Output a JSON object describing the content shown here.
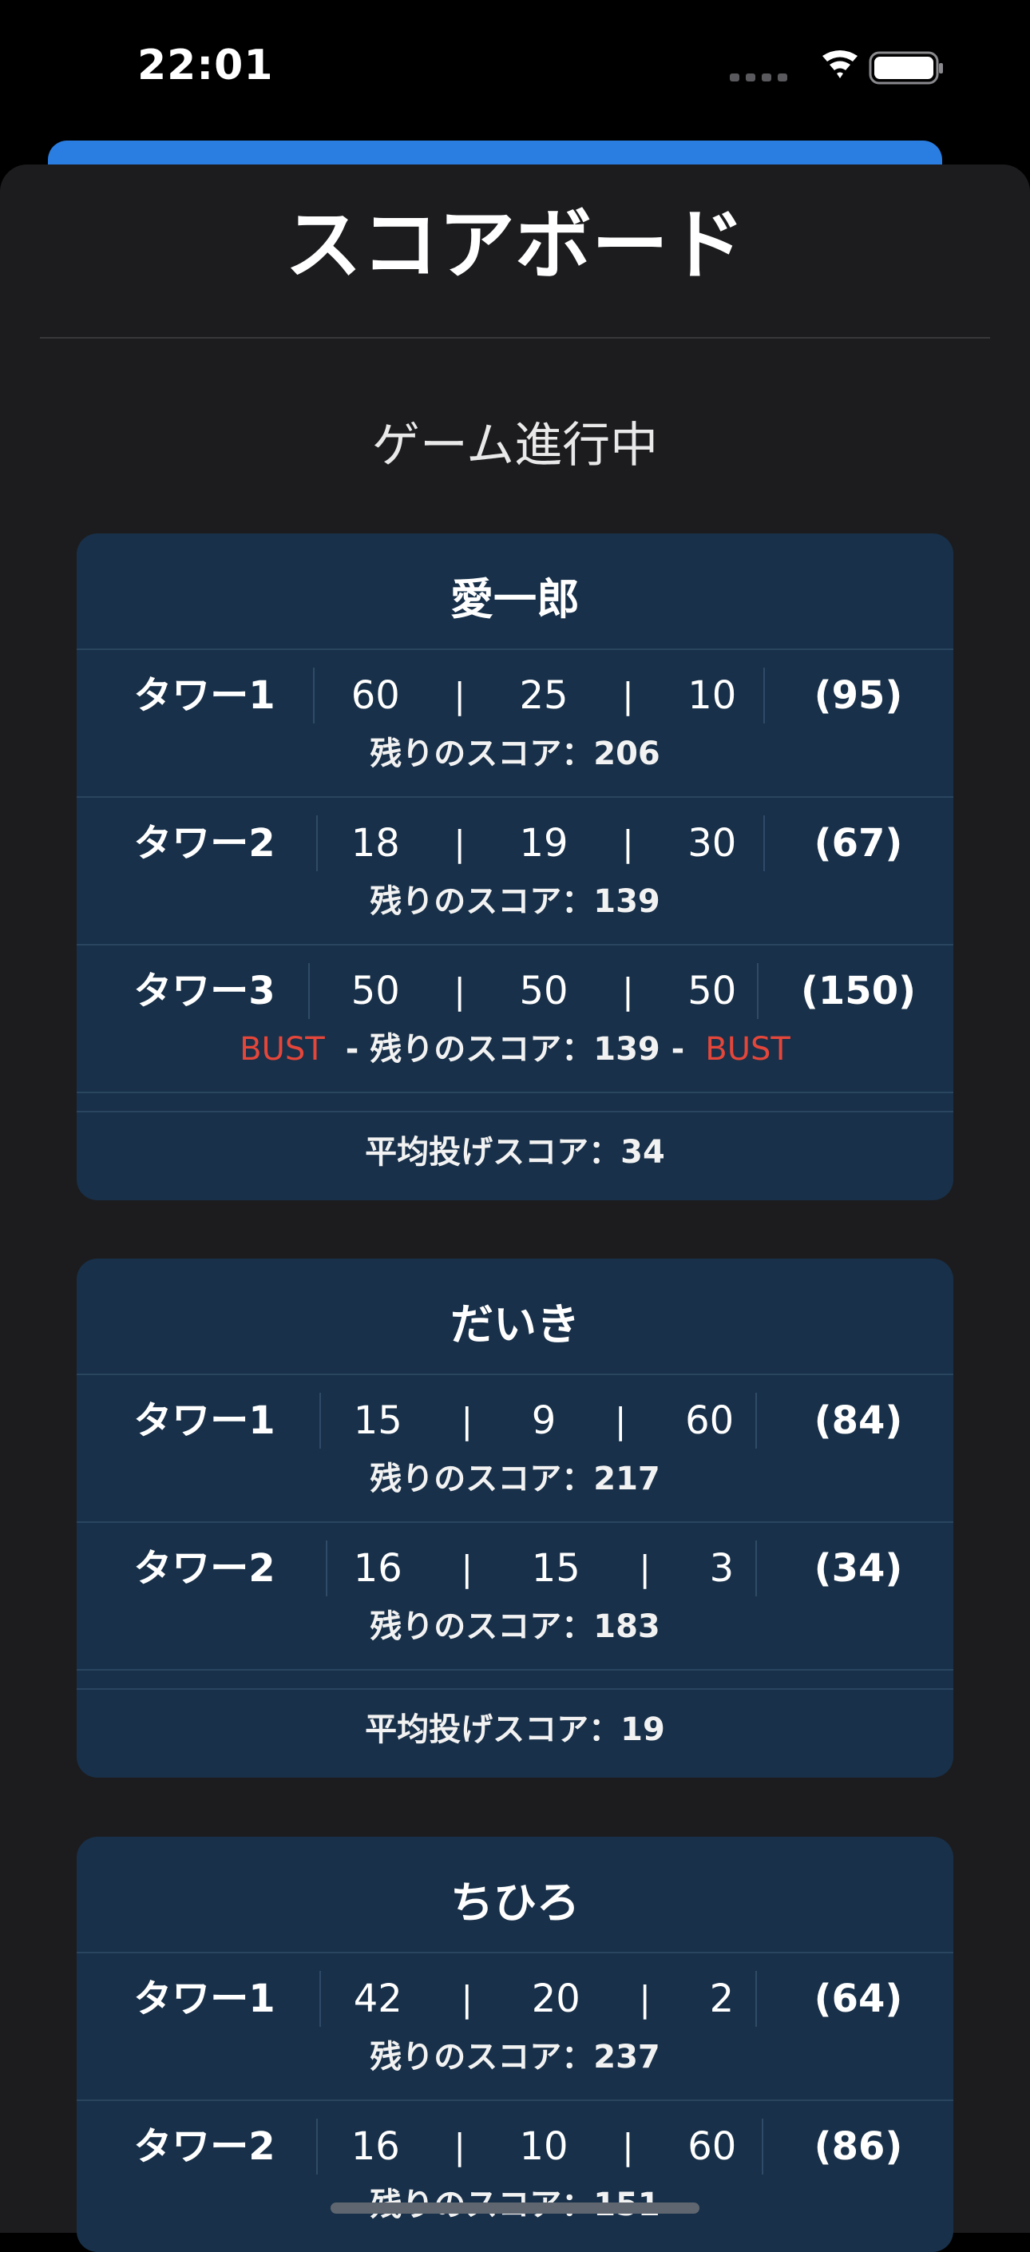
{
  "status_bar": {
    "time": "22:01"
  },
  "sheet": {
    "title": "スコアボード",
    "game_status": "ゲーム進行中"
  },
  "colors": {
    "background": "#1c1c1e",
    "card": "#183049",
    "bust": "#e5463a",
    "accent": "#2a7de1"
  },
  "players": [
    {
      "name": "愛一郎",
      "towers": [
        {
          "label": "タワー1",
          "throws": [
            "60",
            "25",
            "10"
          ],
          "total": "(95)",
          "remaining": "残りのスコア：206",
          "bust_left": "",
          "bust_right": ""
        },
        {
          "label": "タワー2",
          "throws": [
            "18",
            "19",
            "30"
          ],
          "total": "(67)",
          "remaining": "残りのスコア：139",
          "bust_left": "",
          "bust_right": ""
        },
        {
          "label": "タワー3",
          "throws": [
            "50",
            "50",
            "50"
          ],
          "total": "(150)",
          "remaining": "- 残りのスコア：139 -",
          "bust_left": "BUST",
          "bust_right": "BUST"
        }
      ],
      "average": "平均投げスコア：34"
    },
    {
      "name": "だいき",
      "towers": [
        {
          "label": "タワー1",
          "throws": [
            "15",
            "9",
            "60"
          ],
          "total": "(84)",
          "remaining": "残りのスコア：217"
        },
        {
          "label": "タワー2",
          "throws": [
            "16",
            "15",
            "3"
          ],
          "total": "(34)",
          "remaining": "残りのスコア：183"
        }
      ],
      "average": "平均投げスコア：19"
    },
    {
      "name": "ちひろ",
      "towers": [
        {
          "label": "タワー1",
          "throws": [
            "42",
            "20",
            "2"
          ],
          "total": "(64)",
          "remaining": "残りのスコア：237"
        },
        {
          "label": "タワー2",
          "throws": [
            "16",
            "10",
            "60"
          ],
          "total": "(86)",
          "remaining": "残りのスコア：151"
        }
      ]
    }
  ]
}
